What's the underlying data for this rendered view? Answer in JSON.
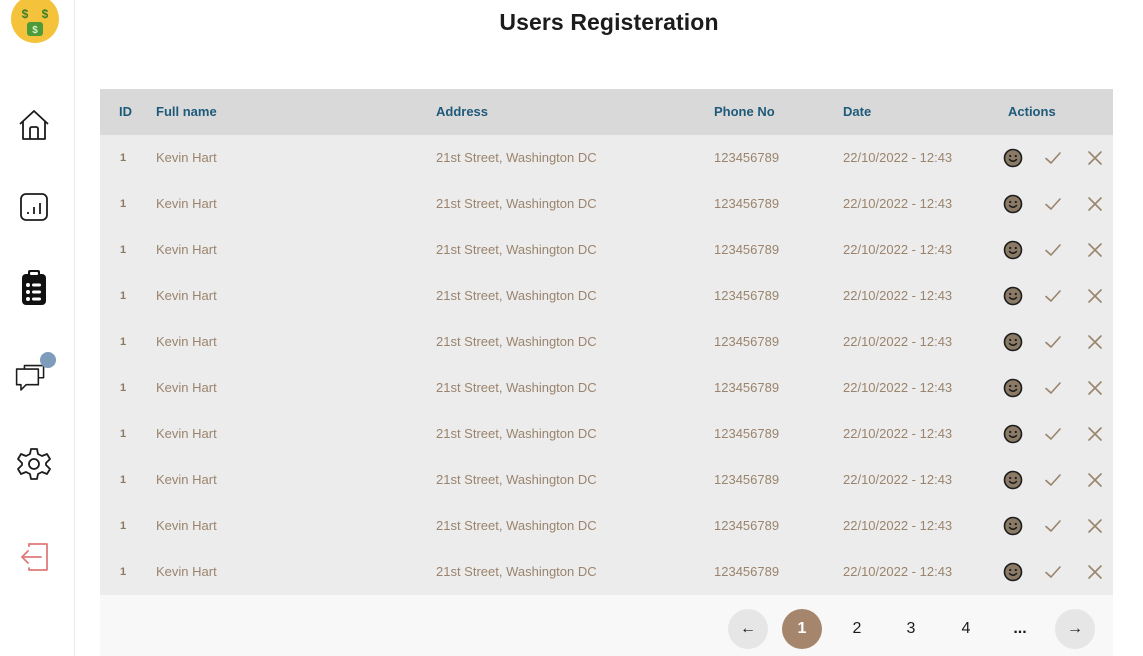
{
  "sidebar": {
    "logo_text": "$ $",
    "items": [
      {
        "name": "home",
        "icon": "home-icon"
      },
      {
        "name": "stats",
        "icon": "bar-chart-icon"
      },
      {
        "name": "registrations",
        "icon": "clipboard-icon",
        "active": true
      },
      {
        "name": "messages",
        "icon": "chat-icon",
        "badge_color": "#7f9cbc"
      },
      {
        "name": "settings",
        "icon": "gear-icon"
      },
      {
        "name": "logout",
        "icon": "logout-icon",
        "color": "#e07a7a"
      }
    ]
  },
  "page": {
    "title": "Users Registeration"
  },
  "table": {
    "columns": [
      "ID",
      "Full name",
      "Address",
      "Phone No",
      "Date",
      "Actions"
    ],
    "rows": [
      {
        "id": "1",
        "name": "Kevin Hart",
        "address": "21st Street, Washington DC",
        "phone": "123456789",
        "date": "22/10/2022 - 12:43"
      },
      {
        "id": "1",
        "name": "Kevin Hart",
        "address": "21st  Street, Washington DC",
        "phone": "123456789",
        "date": "22/10/2022 - 12:43"
      },
      {
        "id": "1",
        "name": "Kevin Hart",
        "address": "21st  Street, Washington DC",
        "phone": "123456789",
        "date": "22/10/2022 - 12:43"
      },
      {
        "id": "1",
        "name": "Kevin Hart",
        "address": "21st  Street, Washington DC",
        "phone": "123456789",
        "date": "22/10/2022 - 12:43"
      },
      {
        "id": "1",
        "name": "Kevin Hart",
        "address": "21st  Street, Washington DC",
        "phone": "123456789",
        "date": "22/10/2022 - 12:43"
      },
      {
        "id": "1",
        "name": "Kevin Hart",
        "address": "21st  Street, Washington DC",
        "phone": "123456789",
        "date": "22/10/2022 - 12:43"
      },
      {
        "id": "1",
        "name": "Kevin Hart",
        "address": "21st  Street, Washington DC",
        "phone": "123456789",
        "date": "22/10/2022 - 12:43"
      },
      {
        "id": "1",
        "name": "Kevin Hart",
        "address": "21st  Street, Washington DC",
        "phone": "123456789",
        "date": "22/10/2022 - 12:43"
      },
      {
        "id": "1",
        "name": "Kevin Hart",
        "address": "21st  Street, Washington DC",
        "phone": "123456789",
        "date": "22/10/2022 - 12:43"
      },
      {
        "id": "1",
        "name": "Kevin Hart",
        "address": "21st  Street, Washington DC",
        "phone": "123456789",
        "date": "22/10/2022 - 12:43"
      }
    ],
    "row_actions": [
      "smiley-icon",
      "check-icon",
      "close-icon"
    ]
  },
  "pagination": {
    "prev": "←",
    "pages": [
      "1",
      "2",
      "3",
      "4"
    ],
    "current": "1",
    "ellipsis": "...",
    "next": "→"
  },
  "colors": {
    "accent": "#a5866d",
    "header_text": "#1e5a7a",
    "cell_text": "#9a846d",
    "logout": "#e07a7a",
    "badge": "#7f9cbc"
  }
}
